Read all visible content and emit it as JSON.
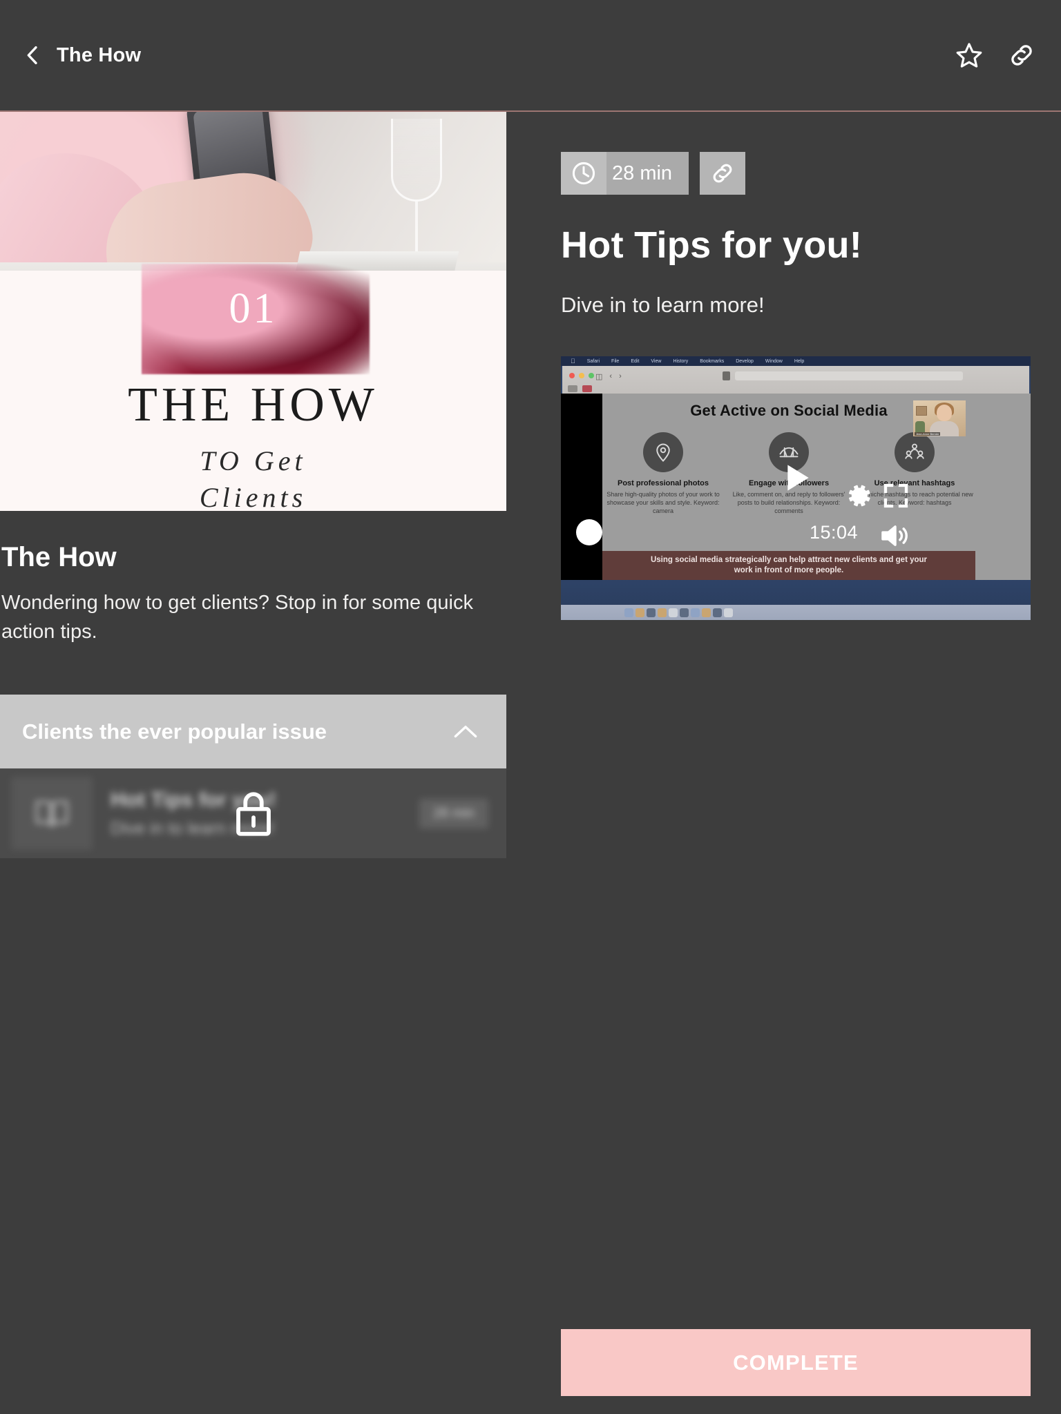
{
  "header": {
    "title": "The How",
    "back_icon": "chevron-left-icon",
    "favorite_icon": "star-icon",
    "share_icon": "link-icon"
  },
  "cover": {
    "number": "01",
    "title": "THE HOW",
    "subtitle_line1": "TO  Get",
    "subtitle_line2": "Clients"
  },
  "course": {
    "title": "The How",
    "description": "Wondering how to get clients? Stop in for some quick action tips."
  },
  "accordion": {
    "title": "Clients the ever popular issue",
    "toggle_icon": "chevron-up-icon",
    "expanded": true
  },
  "lesson_row": {
    "thumb_icon": "book-icon",
    "name": "Hot Tips for you!",
    "subtitle": "Dive in to learn more!",
    "duration": "28 min",
    "locked": true,
    "lock_icon": "lock-icon"
  },
  "detail": {
    "duration_badge": "28 min",
    "clock_icon": "clock-icon",
    "link_icon": "link-icon",
    "title": "Hot Tips for you!",
    "subtitle": "Dive in to learn more!"
  },
  "video": {
    "menubar": [
      "Safari",
      "File",
      "Edit",
      "View",
      "History",
      "Bookmarks",
      "Develop",
      "Window",
      "Help"
    ],
    "apple_glyph": "",
    "slide_title": "Get Active on Social Media",
    "columns": [
      {
        "icon": "location-pin-icon",
        "heading": "Post professional photos",
        "body": "Share high-quality photos of your work to showcase your skills and style. Keyword: camera"
      },
      {
        "icon": "bridge-icon",
        "heading": "Engage with followers",
        "body": "Like, comment on, and reply to followers' posts to build relationships. Keyword: comments"
      },
      {
        "icon": "people-group-icon",
        "heading": "Use relevant hashtags",
        "body": "Use niche hashtags to reach potential new clients. Keyword: hashtags"
      }
    ],
    "caption": "Using social media strategically can help attract new clients and get your work in front of more people.",
    "webcam_name": "Jean-Anne Bernier",
    "controls": {
      "play_icon": "play-icon",
      "settings_icon": "gear-icon",
      "fullscreen_icon": "fullscreen-icon",
      "volume_icon": "volume-on-icon",
      "time": "15:04",
      "scrubber_position": "0"
    }
  },
  "footer": {
    "complete_label": "COMPLETE"
  },
  "colors": {
    "page_background": "#3d3d3d",
    "header_rule": "#9d7673",
    "accent_pink": "#f9c8c6",
    "accordion_background": "#c8c8c8",
    "text_primary": "#ffffff"
  }
}
